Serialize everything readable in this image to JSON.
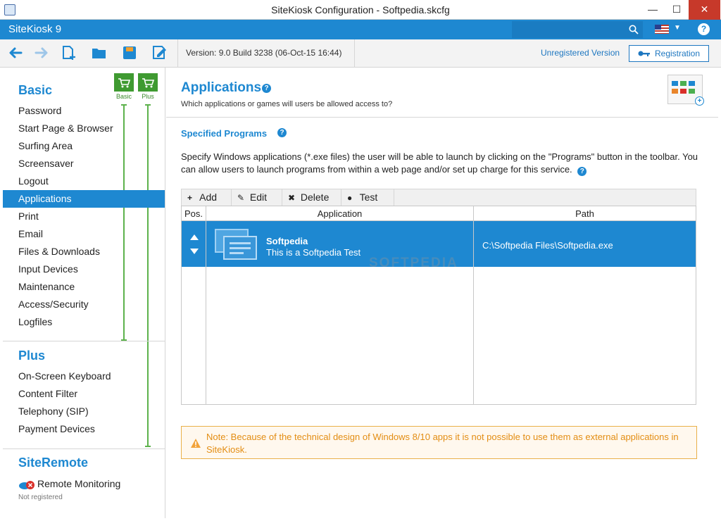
{
  "window": {
    "title": "SiteKiosk Configuration - Softpedia.skcfg",
    "minimize": "—",
    "maximize": "☐",
    "close": "✕"
  },
  "appbar": {
    "name": "SiteKiosk 9",
    "search_value": "",
    "search_placeholder": "",
    "help": "?",
    "language_icon": "us-flag-icon"
  },
  "toolbar": {
    "version": "Version: 9.0 Build 3238 (06-Oct-15 16:44)",
    "unregistered": "Unregistered Version",
    "registration": "Registration",
    "icons": [
      "back-arrow-icon",
      "forward-arrow-icon",
      "new-file-icon",
      "open-folder-icon",
      "save-icon",
      "save-as-icon"
    ]
  },
  "sidebar": {
    "basic_header": "Basic",
    "cart_basic": "Basic",
    "cart_plus": "Plus",
    "basic_items": [
      {
        "label": "Password"
      },
      {
        "label": "Start Page & Browser"
      },
      {
        "label": "Surfing Area"
      },
      {
        "label": "Screensaver"
      },
      {
        "label": "Logout"
      },
      {
        "label": "Applications",
        "active": true
      },
      {
        "label": "Print"
      },
      {
        "label": "Email"
      },
      {
        "label": "Files & Downloads"
      },
      {
        "label": "Input Devices"
      },
      {
        "label": "Maintenance"
      },
      {
        "label": "Access/Security"
      },
      {
        "label": "Logfiles"
      }
    ],
    "plus_header": "Plus",
    "plus_items": [
      {
        "label": "On-Screen Keyboard"
      },
      {
        "label": "Content Filter"
      },
      {
        "label": "Telephony (SIP)"
      },
      {
        "label": "Payment Devices"
      }
    ],
    "siteremote_header": "SiteRemote",
    "remote_monitoring": "Remote Monitoring",
    "remote_status": "Not registered"
  },
  "main": {
    "title": "Applications",
    "subtitle": "Which applications or games will users be allowed access to?",
    "section_title": "Specified Programs",
    "description": "Specify Windows applications (*.exe files) the user will be able to launch by clicking on the \"Programs\" button in the toolbar. You can allow users to launch programs from within a web page and/or set up charge for this service.",
    "help": "?",
    "grid_buttons": {
      "add": "Add",
      "edit": "Edit",
      "delete": "Delete",
      "test": "Test"
    },
    "columns": [
      "Pos.",
      "Application",
      "Path"
    ],
    "rows": [
      {
        "name": "Softpedia",
        "description": "This is a Softpedia Test",
        "path": "C:\\Softpedia Files\\Softpedia.exe"
      }
    ],
    "note": "Note: Because of the technical design of Windows 8/10 apps it is not possible to use them as external applications in SiteKiosk.",
    "watermark": "SOFTPEDIA"
  },
  "colors": {
    "accent": "#1e88d1",
    "cart_green": "#3f9a31",
    "note_orange": "#e38d13",
    "close_red": "#c7392a"
  }
}
